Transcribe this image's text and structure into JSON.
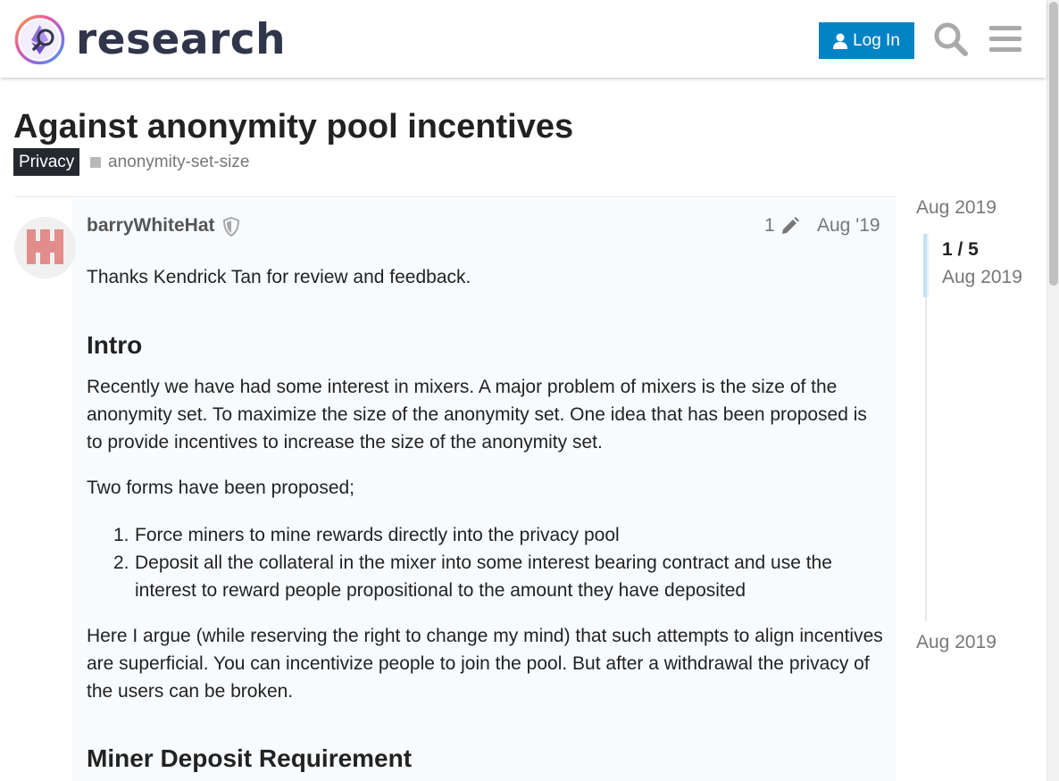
{
  "header": {
    "logo_text": "research",
    "login_label": "Log In"
  },
  "topic": {
    "title": "Against anonymity pool incentives",
    "category": "Privacy",
    "tag": "anonymity-set-size"
  },
  "post": {
    "username": "barryWhiteHat",
    "edit_count": "1",
    "date": "Aug '19",
    "thanks": "Thanks Kendrick Tan for review and feedback.",
    "heading_intro": "Intro",
    "paragraph_1": "Recently we have had some interest in mixers. A major problem of mixers is the size of the anonymity set. To maximize the size of the anonymity set. One idea that has been proposed is to provide incentives to increase the size of the anonymity set.",
    "paragraph_2": "Two forms have been proposed;",
    "list": [
      {
        "num": "1.",
        "text": "Force miners to mine rewards directly into the privacy pool"
      },
      {
        "num": "2.",
        "text": "Deposit all the collateral in the mixer into some interest bearing contract and use the interest to reward people propositional to the amount they have deposited"
      }
    ],
    "paragraph_3": "Here I argue (while reserving the right to change my mind) that such attempts to align incentives are superficial. You can incentivize people to join the pool. But after a withdrawal the privacy of the users can be broken.",
    "heading_miner": "Miner Deposit Requirement"
  },
  "timeline": {
    "start_date": "Aug 2019",
    "position": "1 / 5",
    "current_date": "Aug 2019",
    "end_date": "Aug 2019"
  },
  "colors": {
    "login_bg": "#0083c4",
    "category_bg": "#25292f",
    "post_bg": "#f8fbfe",
    "avatar_color": "#e28c8c"
  }
}
